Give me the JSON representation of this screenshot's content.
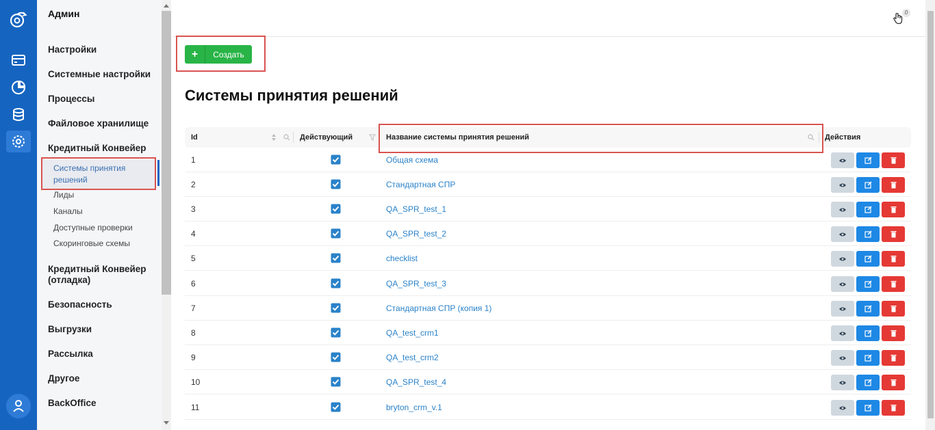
{
  "sidebar": {
    "title": "Админ",
    "items": [
      {
        "label": "Настройки"
      },
      {
        "label": "Системные настройки"
      },
      {
        "label": "Процессы"
      },
      {
        "label": "Файловое хранилище"
      },
      {
        "label": "Кредитный Конвейер"
      },
      {
        "label": "Кредитный Конвейер (отладка)"
      },
      {
        "label": "Безопасность"
      },
      {
        "label": "Выгрузки"
      },
      {
        "label": "Рассылка"
      },
      {
        "label": "Другое"
      },
      {
        "label": "BackOffice"
      }
    ],
    "subitems": [
      {
        "label": "Системы принятия решений"
      },
      {
        "label": "Лиды"
      },
      {
        "label": "Каналы"
      },
      {
        "label": "Доступные проверки"
      },
      {
        "label": "Скоринговые схемы"
      }
    ]
  },
  "topbar": {
    "badge": "0",
    "icon": "hand-icon"
  },
  "toolbar": {
    "create_label": "Создать"
  },
  "page": {
    "title": "Системы принятия решений"
  },
  "table": {
    "headers": {
      "id": "Id",
      "active": "Действующий",
      "name": "Название системы принятия решений",
      "actions": "Действия"
    },
    "rows": [
      {
        "id": "1",
        "name": "Общая схема",
        "active": true
      },
      {
        "id": "2",
        "name": "Стандартная СПР",
        "active": true
      },
      {
        "id": "3",
        "name": "QA_SPR_test_1",
        "active": true
      },
      {
        "id": "4",
        "name": "QA_SPR_test_2",
        "active": true
      },
      {
        "id": "5",
        "name": "checklist",
        "active": true
      },
      {
        "id": "6",
        "name": "QA_SPR_test_3",
        "active": true
      },
      {
        "id": "7",
        "name": "Стандартная СПР (копия 1)",
        "active": true
      },
      {
        "id": "8",
        "name": "QA_test_crm1",
        "active": true
      },
      {
        "id": "9",
        "name": "QA_test_crm2",
        "active": true
      },
      {
        "id": "10",
        "name": "QA_SPR_test_4",
        "active": true
      },
      {
        "id": "11",
        "name": "bryton_crm_v.1",
        "active": true
      }
    ]
  },
  "colors": {
    "rail": "#1565c0",
    "create": "#28b446",
    "link": "#2a82c9",
    "edit": "#1e88e5",
    "delete": "#e53935",
    "highlight": "#d9534f"
  }
}
